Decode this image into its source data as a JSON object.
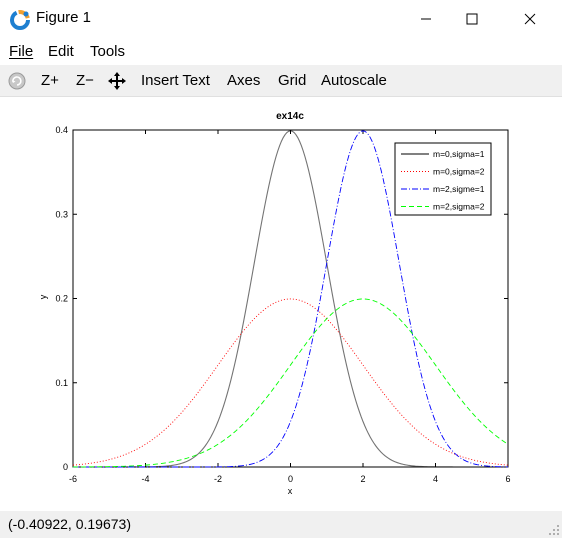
{
  "window": {
    "title": "Figure 1",
    "minimize_glyph": "—",
    "maximize_glyph": "☐",
    "close_glyph": "✕"
  },
  "menu": {
    "file": "File",
    "edit": "Edit",
    "tools": "Tools"
  },
  "toolbar": {
    "rotate_icon": "rotate-icon",
    "zoom_in": "Z+",
    "zoom_out": "Z−",
    "pan_icon": "pan-icon",
    "insert_text": "Insert Text",
    "axes": "Axes",
    "grid": "Grid",
    "autoscale": "Autoscale"
  },
  "status": {
    "coords": "(-0.40922, 0.19673)"
  },
  "chart_data": {
    "type": "line",
    "title": "ex14c",
    "xlabel": "x",
    "ylabel": "y",
    "xlim": [
      -6,
      6
    ],
    "ylim": [
      0,
      0.4
    ],
    "xticks": [
      "-6",
      "-4",
      "-2",
      "0",
      "2",
      "4",
      "6"
    ],
    "yticks": [
      "0",
      "0.1",
      "0.2",
      "0.3",
      "0.4"
    ],
    "grid": false,
    "legend_position": "top-right",
    "series": [
      {
        "name": "m=0,sigma=1",
        "mean": 0,
        "sigma": 1,
        "color": "#000000",
        "dash": "none"
      },
      {
        "name": "m=0,sigma=2",
        "mean": 0,
        "sigma": 2,
        "color": "#ff0000",
        "dash": "1,2"
      },
      {
        "name": "m=2,sigme=1",
        "mean": 2,
        "sigma": 1,
        "color": "#0000ff",
        "dash": "6,2,1,2"
      },
      {
        "name": "m=2,sigma=2",
        "mean": 2,
        "sigma": 2,
        "color": "#00ff00",
        "dash": "5,3"
      }
    ]
  }
}
